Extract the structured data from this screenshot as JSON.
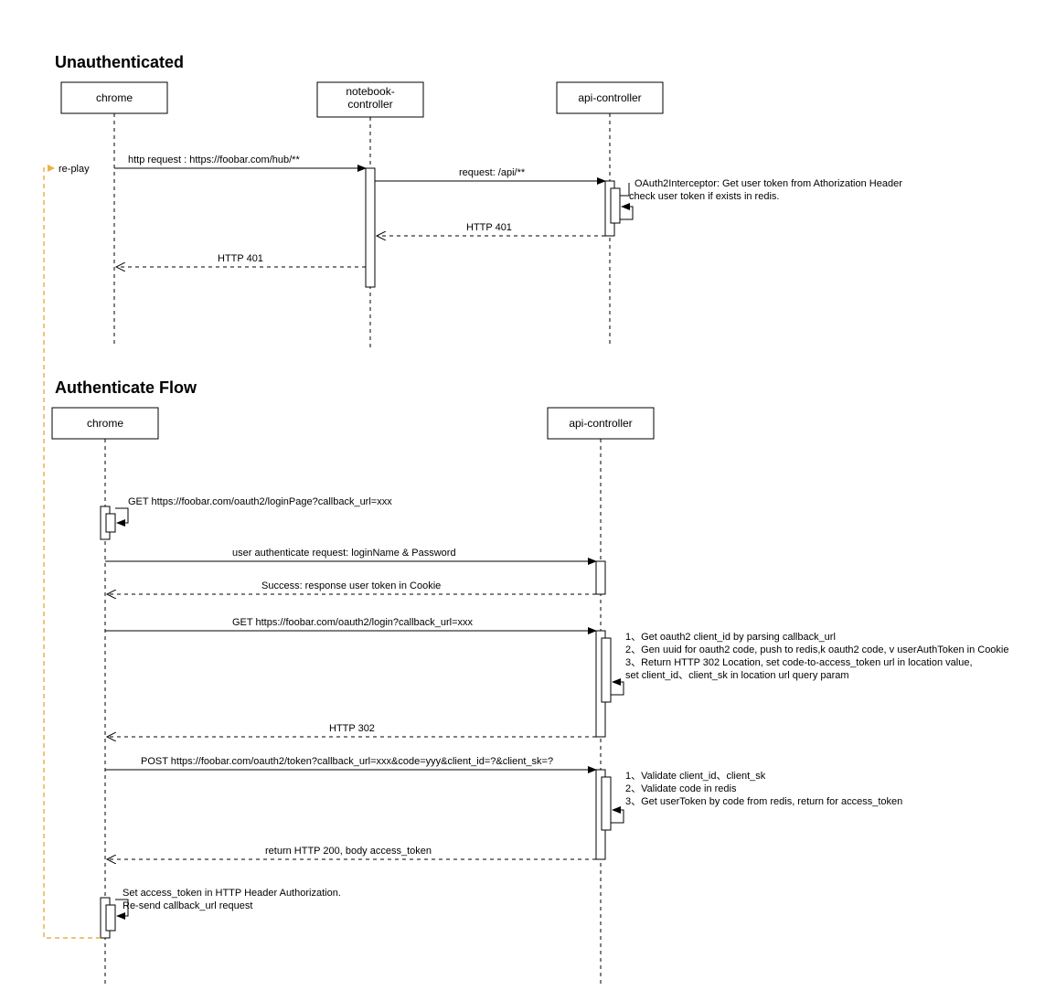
{
  "section1": {
    "title": "Unauthenticated",
    "actors": {
      "chrome": "chrome",
      "notebook": "notebook-controller",
      "api": "api-controller"
    },
    "messages": {
      "m1": "http request : https://foobar.com/hub/**",
      "m2": "request: /api/**",
      "ann1": "OAuth2Interceptor: Get user token from Athorization Header",
      "ann2": "check user token if exists in redis.",
      "m3": "HTTP 401",
      "m4": "HTTP 401"
    }
  },
  "section2": {
    "title": "Authenticate Flow",
    "actors": {
      "chrome": "chrome",
      "api": "api-controller"
    },
    "messages": {
      "m1": "GET https://foobar.com/oauth2/loginPage?callback_url=xxx",
      "m2": "user authenticate request: loginName & Password",
      "m3": "Success: response user token in Cookie",
      "m4": "GET https://foobar.com/oauth2/login?callback_url=xxx",
      "ann4a": "1、Get oauth2 client_id by parsing callback_url",
      "ann4b": "2、Gen uuid for oauth2 code, push to redis,k oauth2 code, v userAuthToken in Cookie",
      "ann4c": "3、Return HTTP 302 Location, set code-to-access_token url in location value,",
      "ann4d": "set client_id、client_sk in location url query param",
      "m5": "HTTP 302",
      "m6": "POST https://foobar.com/oauth2/token?callback_url=xxx&code=yyy&client_id=?&client_sk=?",
      "ann6a": "1、Validate client_id、client_sk",
      "ann6b": "2、Validate code in redis",
      "ann6c": "3、Get userToken by code from redis, return for access_token",
      "m7": "return HTTP 200, body  access_token",
      "m8a": "Set access_token in HTTP Header Authorization.",
      "m8b": "Re-send callback_url request"
    }
  },
  "replay": "re-play"
}
